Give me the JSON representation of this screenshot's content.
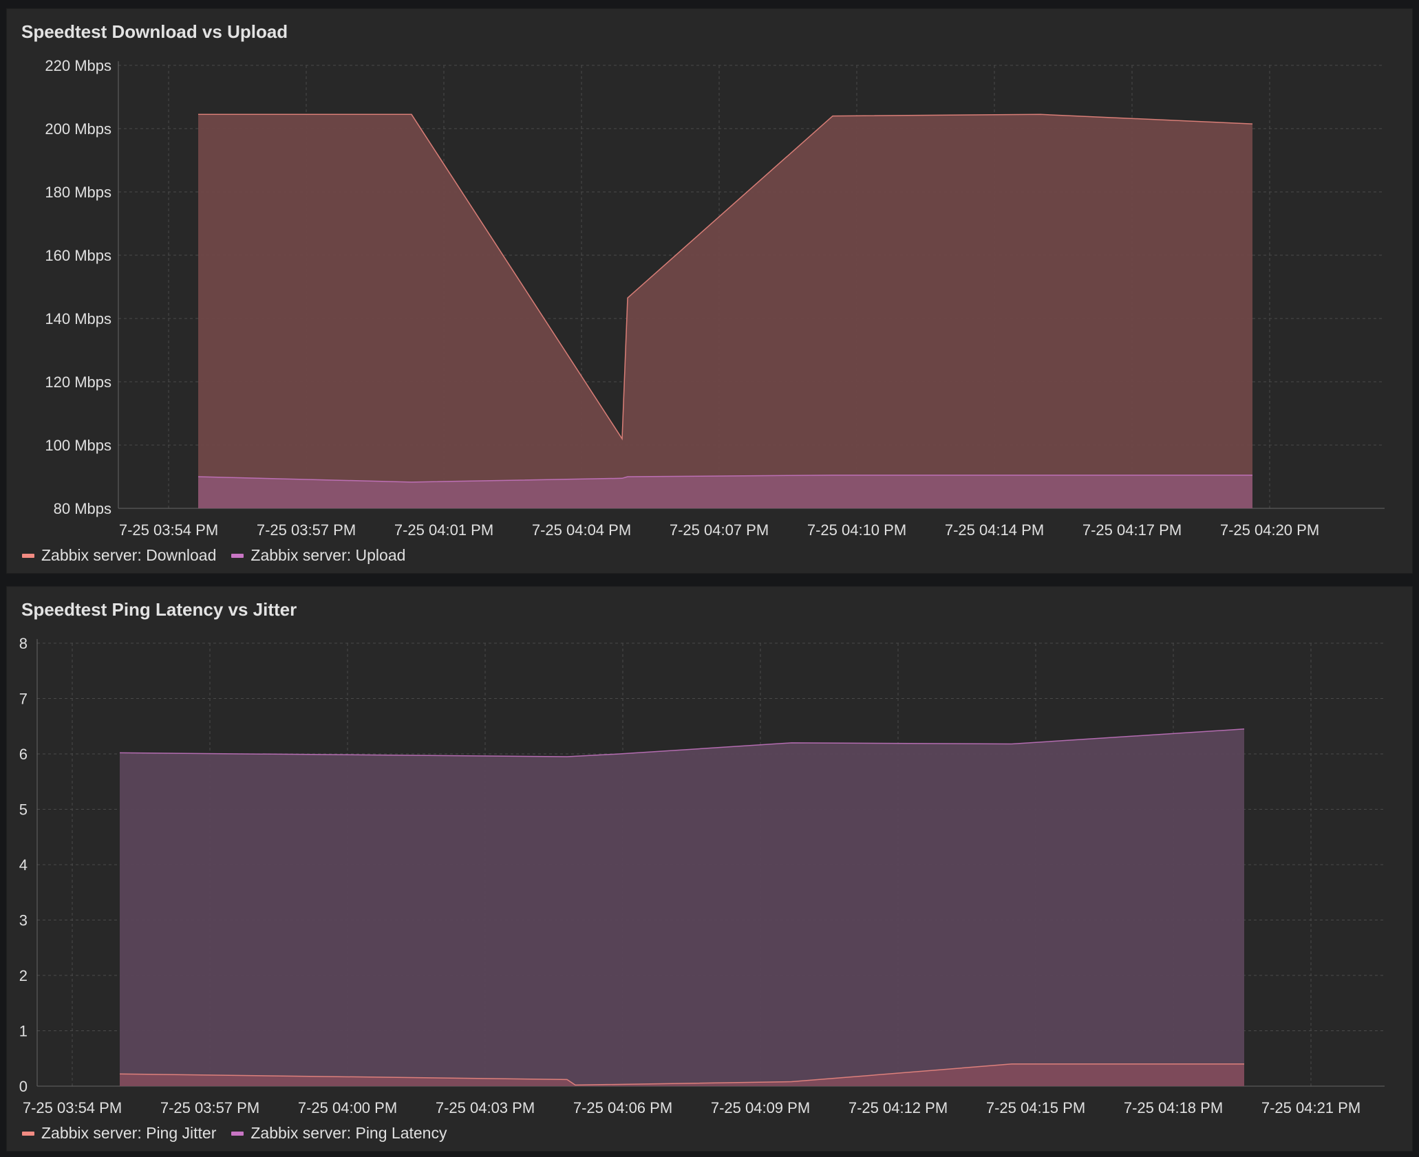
{
  "colors": {
    "series_a": "#f28b82",
    "series_b": "#c875c4",
    "fill_a": "#6f4747",
    "fill_b": "#8a5470",
    "fill_latency": "#5a4459",
    "fill_jitter": "#7f4b5b"
  },
  "panels": [
    {
      "title": "Speedtest Download vs Upload",
      "legend": [
        {
          "label": "Zabbix server: Download",
          "color": "#f28b82"
        },
        {
          "label": "Zabbix server: Upload",
          "color": "#c875c4"
        }
      ]
    },
    {
      "title": "Speedtest Ping Latency vs Jitter",
      "legend": [
        {
          "label": "Zabbix server: Ping Jitter",
          "color": "#f28b82"
        },
        {
          "label": "Zabbix server: Ping Latency",
          "color": "#c875c4"
        }
      ]
    }
  ],
  "chart_data": [
    {
      "type": "area",
      "title": "Speedtest Download vs Upload",
      "ylim": [
        80,
        220
      ],
      "yticks": [
        "80 Mbps",
        "100 Mbps",
        "120 Mbps",
        "140 Mbps",
        "160 Mbps",
        "180 Mbps",
        "200 Mbps",
        "220 Mbps"
      ],
      "xticks": [
        "7-25 03:54 PM",
        "7-25 03:57 PM",
        "7-25 04:01 PM",
        "7-25 04:04 PM",
        "7-25 04:07 PM",
        "7-25 04:10 PM",
        "7-25 04:14 PM",
        "7-25 04:17 PM",
        "7-25 04:20 PM"
      ],
      "grid": true,
      "legend_position": "bottom-left",
      "series": [
        {
          "name": "Zabbix server: Download",
          "points": [
            [
              "7-25 03:56 PM",
              204.5
            ],
            [
              "7-25 04:01 PM",
              204.5
            ],
            [
              "7-25 04:05 PM",
              102
            ],
            [
              "7-25 04:05 PM",
              146.5
            ],
            [
              "7-25 04:10 PM",
              204
            ],
            [
              "7-25 04:15 PM",
              204.5
            ],
            [
              "7-25 04:19 PM",
              201.5
            ]
          ]
        },
        {
          "name": "Zabbix server: Upload",
          "points": [
            [
              "7-25 03:56 PM",
              90
            ],
            [
              "7-25 04:01 PM",
              88.3
            ],
            [
              "7-25 04:05 PM",
              89.5
            ],
            [
              "7-25 04:05 PM",
              90
            ],
            [
              "7-25 04:10 PM",
              90.5
            ],
            [
              "7-25 04:15 PM",
              90.5
            ],
            [
              "7-25 04:19 PM",
              90.5
            ]
          ]
        }
      ]
    },
    {
      "type": "area",
      "title": "Speedtest Ping Latency vs Jitter",
      "ylim": [
        0,
        8
      ],
      "yticks": [
        "0",
        "1",
        "2",
        "3",
        "4",
        "5",
        "6",
        "7",
        "8"
      ],
      "xticks": [
        "7-25 03:54 PM",
        "7-25 03:57 PM",
        "7-25 04:00 PM",
        "7-25 04:03 PM",
        "7-25 04:06 PM",
        "7-25 04:09 PM",
        "7-25 04:12 PM",
        "7-25 04:15 PM",
        "7-25 04:18 PM",
        "7-25 04:21 PM"
      ],
      "grid": true,
      "legend_position": "bottom-left",
      "series": [
        {
          "name": "Zabbix server: Ping Jitter",
          "points": [
            [
              "7-25 03:55 PM",
              0.22
            ],
            [
              "7-25 04:05 PM",
              0.12
            ],
            [
              "7-25 04:05 PM",
              0.02
            ],
            [
              "7-25 04:09 PM",
              0.08
            ],
            [
              "7-25 04:15 PM",
              0.4
            ],
            [
              "7-25 04:20 PM",
              0.4
            ]
          ]
        },
        {
          "name": "Zabbix server: Ping Latency",
          "points": [
            [
              "7-25 03:55 PM",
              6.02
            ],
            [
              "7-25 04:05 PM",
              5.95
            ],
            [
              "7-25 04:06 PM",
              6.0
            ],
            [
              "7-25 04:09 PM",
              6.2
            ],
            [
              "7-25 04:15 PM",
              6.18
            ],
            [
              "7-25 04:20 PM",
              6.45
            ]
          ]
        }
      ]
    }
  ]
}
